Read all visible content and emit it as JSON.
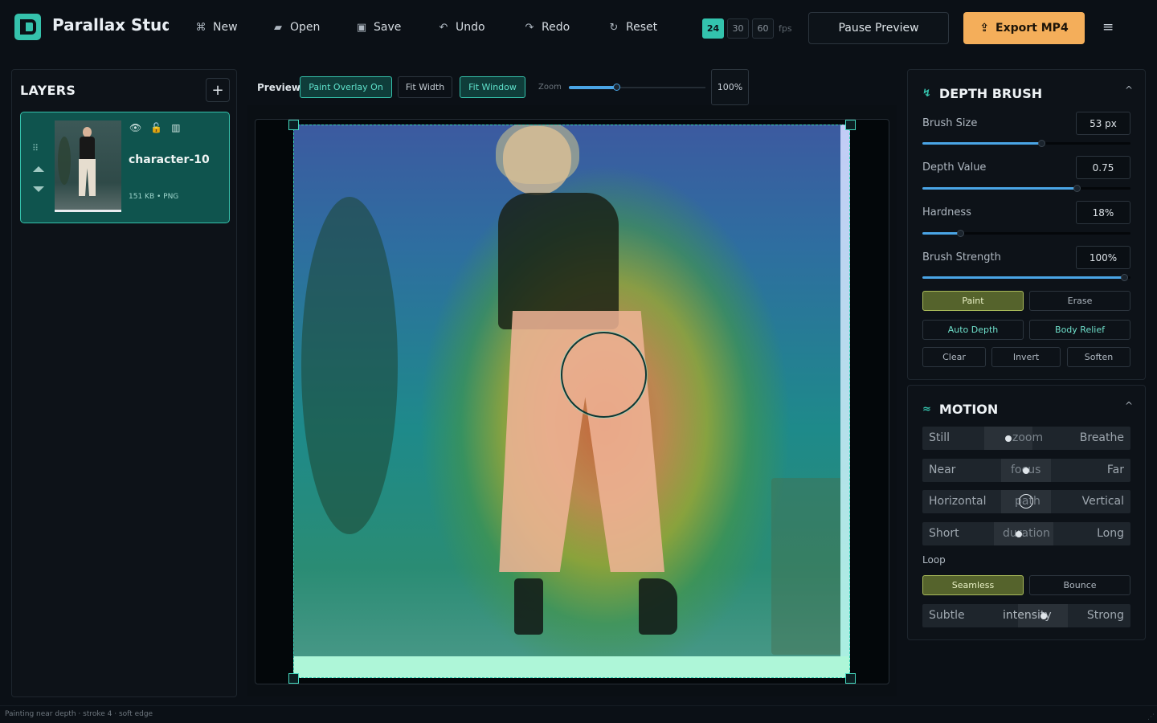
{
  "app": {
    "title": "Parallax Studio"
  },
  "toolbar": {
    "buttons": [
      {
        "label": "New",
        "icon": "⌘"
      },
      {
        "label": "Open",
        "icon": "▰"
      },
      {
        "label": "Save",
        "icon": "▣"
      },
      {
        "label": "Undo",
        "icon": "↶"
      },
      {
        "label": "Redo",
        "icon": "↷"
      },
      {
        "label": "Reset",
        "icon": "↻"
      }
    ],
    "fps_options": [
      "24",
      "30",
      "60"
    ],
    "fps_selected": "24",
    "fps_unit": "fps",
    "pause_label": "Pause Preview",
    "export_label": "Export MP4",
    "export_icon": "⇪",
    "menu_icon": "≡"
  },
  "layers": {
    "title": "LAYERS",
    "add_label": "+",
    "items": [
      {
        "name": "character-10",
        "size": "151 KB",
        "format": "PNG",
        "meta": "151 KB • PNG"
      }
    ]
  },
  "preview": {
    "label": "Preview",
    "overlay_label": "Paint Overlay  On",
    "fit_width": "Fit Width",
    "fit_window": "Fit Window",
    "zoom_label": "Zoom",
    "zoom_value": "100%",
    "zoom_fraction": 0.34
  },
  "depth_brush": {
    "title": "DEPTH BRUSH",
    "icon": "↯",
    "collapse": "^",
    "controls": [
      {
        "label": "Brush Size",
        "value": "53 px",
        "fraction": 0.57
      },
      {
        "label": "Depth Value",
        "value": "0.75",
        "fraction": 0.74
      },
      {
        "label": "Hardness",
        "value": "18%",
        "fraction": 0.18
      },
      {
        "label": "Brush Strength",
        "value": "100%",
        "fraction": 0.97
      }
    ],
    "paint": "Paint",
    "erase": "Erase",
    "auto_depth": "Auto Depth",
    "body_relief": "Body Relief",
    "clear": "Clear",
    "invert": "Invert",
    "soften": "Soften"
  },
  "motion": {
    "title": "MOTION",
    "icon": "≈",
    "collapse": "^",
    "rows": [
      {
        "left": "Still",
        "mid": "zoom",
        "right": "Breathe"
      },
      {
        "left": "Near",
        "mid": "focus",
        "right": "Far"
      },
      {
        "left": "Horizontal",
        "mid": "path",
        "right": "Vertical"
      },
      {
        "left": "Short",
        "mid": "duration",
        "right": "Long"
      }
    ],
    "loop_label": "Loop",
    "seamless": "Seamless",
    "bounce": "Bounce",
    "intensity": {
      "left": "Subtle",
      "mid": "intensity",
      "right": "Strong"
    }
  },
  "status": {
    "text": "Painting near depth · stroke 4 · soft edge"
  }
}
